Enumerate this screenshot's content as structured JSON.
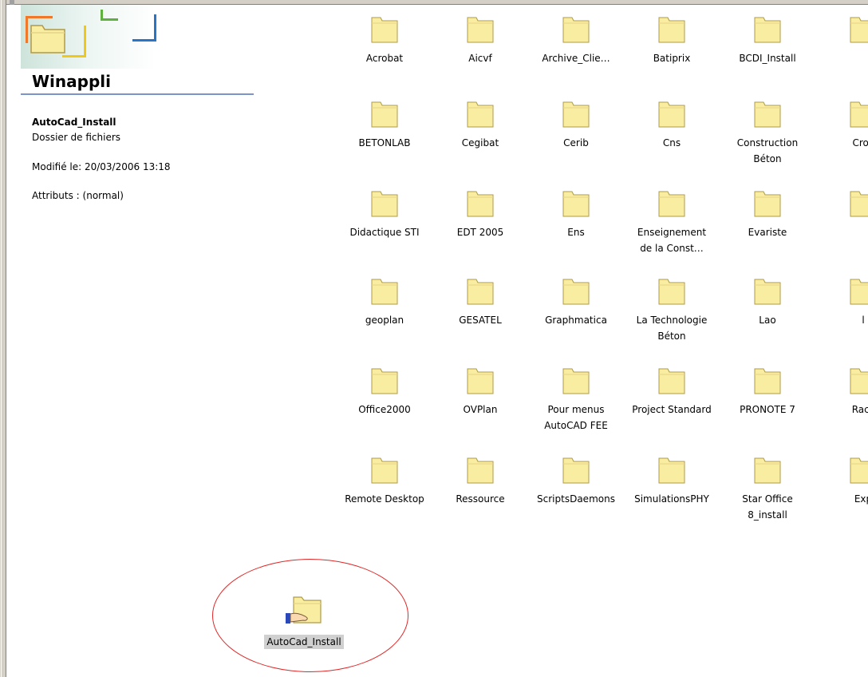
{
  "panel": {
    "title": "Winappli",
    "selected_name": "AutoCad_Install",
    "selected_type": "Dossier de fichiers",
    "modified": "Modifié le: 20/03/2006 13:18",
    "attributes": "Attributs : (normal)"
  },
  "folders": [
    {
      "label": "Acrobat"
    },
    {
      "label": "Aicvf"
    },
    {
      "label": "Archive_Clie…"
    },
    {
      "label": "Batiprix"
    },
    {
      "label": "BCDI_Install"
    },
    {
      "label": ""
    },
    {
      "label": "BETONLAB"
    },
    {
      "label": "Cegibat"
    },
    {
      "label": "Cerib"
    },
    {
      "label": "Cns"
    },
    {
      "label": "Construction\nBéton"
    },
    {
      "label": "Croc"
    },
    {
      "label": "Didactique STI"
    },
    {
      "label": "EDT 2005"
    },
    {
      "label": "Ens"
    },
    {
      "label": "Enseignement\nde la Const…"
    },
    {
      "label": "Evariste"
    },
    {
      "label": ""
    },
    {
      "label": "geoplan"
    },
    {
      "label": "GESATEL"
    },
    {
      "label": "Graphmatica"
    },
    {
      "label": "La Technologie\nBéton"
    },
    {
      "label": "Lao"
    },
    {
      "label": "l"
    },
    {
      "label": "Office2000"
    },
    {
      "label": "OVPlan"
    },
    {
      "label": "Pour menus\nAutoCAD FEE"
    },
    {
      "label": "Project Standard"
    },
    {
      "label": "PRONOTE 7"
    },
    {
      "label": "Racc"
    },
    {
      "label": "Remote Desktop"
    },
    {
      "label": "Ressource"
    },
    {
      "label": "ScriptsDaemons"
    },
    {
      "label": "SimulationsPHY"
    },
    {
      "label": "Star Office\n8_install"
    },
    {
      "label": "Exp"
    }
  ],
  "shared_folder": {
    "label": "AutoCad_Install",
    "icon": "shared-folder-icon"
  },
  "colors": {
    "folder_fill": "#f8eda0",
    "folder_stroke": "#b09a4a",
    "highlight_oval": "#e02828",
    "title_rule": "#7c95c8"
  }
}
